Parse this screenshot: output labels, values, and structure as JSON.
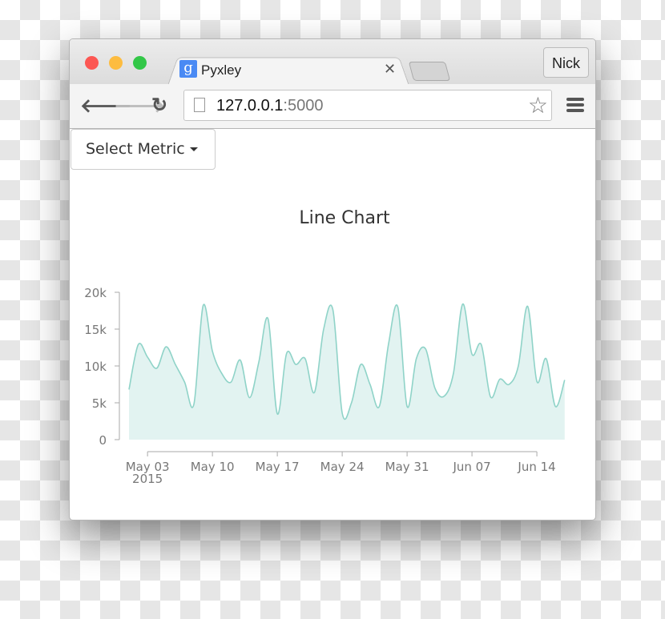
{
  "browser": {
    "tab_title": "Pyxley",
    "favicon_letter": "g",
    "profile_name": "Nick",
    "url_host": "127.0.0.1",
    "url_port": ":5000"
  },
  "page": {
    "select_label": "Select Metric"
  },
  "chart_data": {
    "type": "area",
    "title": "Line Chart",
    "x_start": "2015-05-01",
    "x_end": "2015-06-17",
    "x_ticks": [
      "May 03",
      "May 10",
      "May 17",
      "May 24",
      "May 31",
      "Jun 07",
      "Jun 14"
    ],
    "x_tick_year": "2015",
    "y_ticks": [
      "0",
      "5k",
      "10k",
      "15k",
      "20k"
    ],
    "ylim": [
      0,
      20000
    ],
    "color": "#8fd3c8",
    "fill": "#e2f3f1",
    "values": [
      6800,
      12900,
      11200,
      9700,
      12600,
      10200,
      7800,
      4800,
      18200,
      12000,
      9000,
      7800,
      10800,
      5700,
      10500,
      16400,
      3500,
      11700,
      10200,
      11000,
      6400,
      15000,
      17600,
      3600,
      5000,
      10200,
      7500,
      4500,
      13000,
      18000,
      4500,
      11000,
      12300,
      7000,
      5900,
      9000,
      18400,
      11600,
      12900,
      5800,
      8200,
      7500,
      10000,
      18100,
      7900,
      11000,
      4500,
      8100
    ]
  }
}
